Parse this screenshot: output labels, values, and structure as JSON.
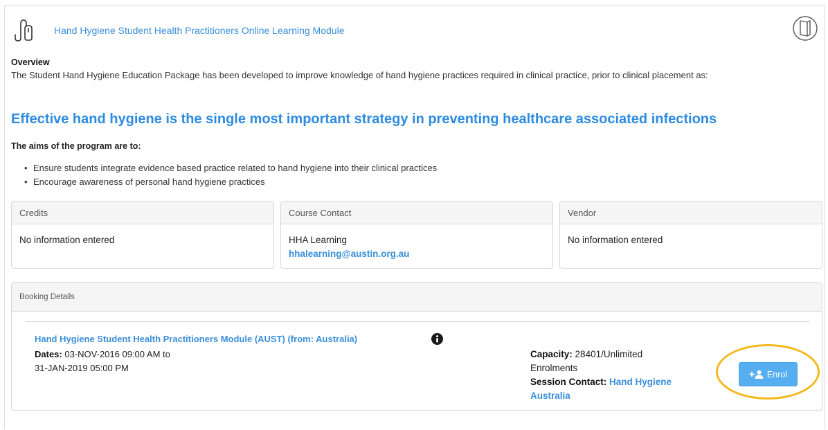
{
  "course": {
    "title": "Hand Hygiene Student Health Practitioners Online Learning Module",
    "icon": "hand-touch-icon",
    "book_icon": "book-icon"
  },
  "overview": {
    "heading": "Overview",
    "text": "The Student Hand Hygiene Education Package has been developed to improve knowledge of hand hygiene practices required in clinical practice, prior to clinical placement as:",
    "headline": "Effective hand hygiene is the single most important strategy in preventing healthcare associated infections"
  },
  "aims": {
    "heading": "The aims of the program are to:",
    "items": [
      "Ensure students integrate evidence based practice related to hand hygiene into their clinical practices",
      "Encourage awareness of personal hand hygiene practices"
    ]
  },
  "panels": {
    "credits": {
      "heading": "Credits",
      "text": "No information entered"
    },
    "contact": {
      "heading": "Course Contact",
      "name": "HHA Learning",
      "email": "hhalearning@austin.org.au"
    },
    "vendor": {
      "heading": "Vendor",
      "text": "No information entered"
    }
  },
  "booking": {
    "heading": "Booking Details",
    "session_title": "Hand Hygiene Student Health Practitioners Module (AUST) (from: Australia)",
    "dates_label": "Dates:",
    "dates_start": "03-NOV-2016 09:00 AM to",
    "dates_end": "31-JAN-2019 05:00 PM",
    "capacity_label": "Capacity:",
    "capacity_value": "28401/Unlimited",
    "capacity_suffix": "Enrolments",
    "session_contact_label": "Session Contact:",
    "session_contact_value": "Hand Hygiene Australia",
    "enrol_label": "Enrol"
  },
  "colors": {
    "link": "#3a8fd9",
    "headline": "#2d8be0",
    "button": "#55aef0",
    "highlight": "#f3b81d"
  }
}
